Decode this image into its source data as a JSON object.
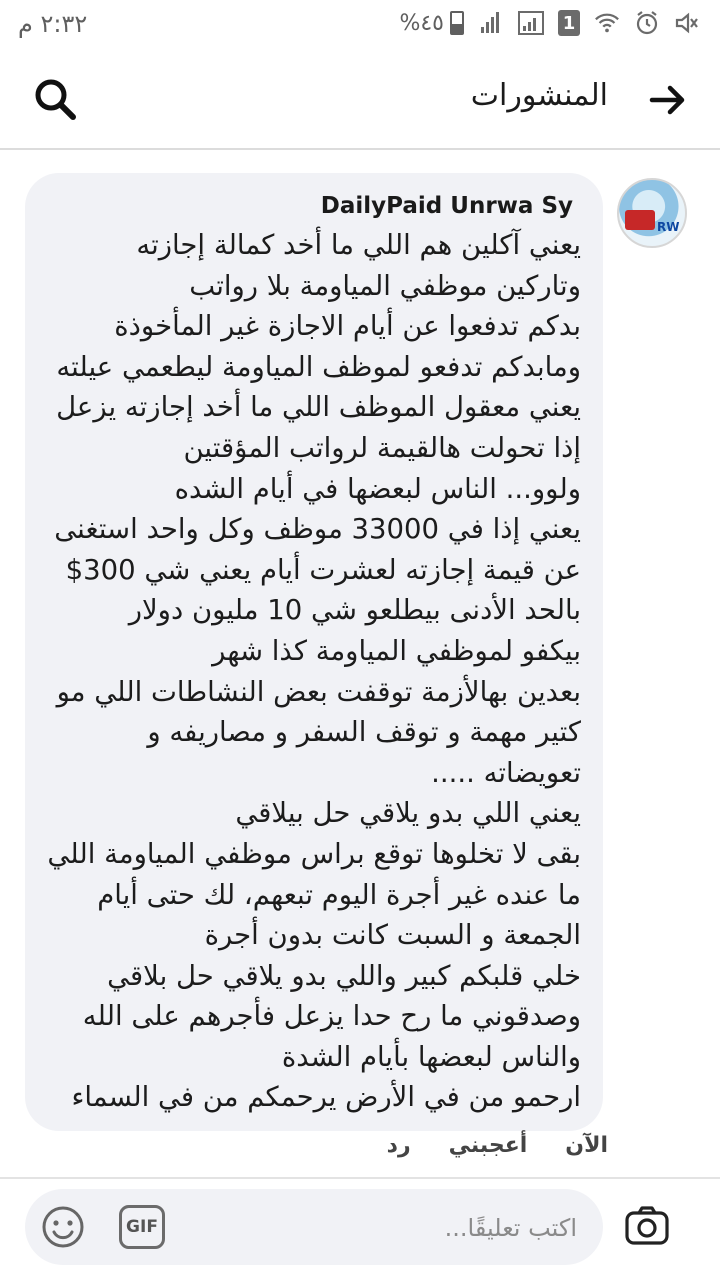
{
  "status_bar": {
    "time": "٢:٣٢ م",
    "battery": "%٤٥",
    "notification_badge": "1"
  },
  "header": {
    "title": "المنشورات"
  },
  "comment": {
    "author": "DailyPaid Unrwa Sy",
    "avatar_text": "RW",
    "lines": [
      "يعني آكلين هم اللي ما أخد كمالة إجازته",
      "وتاركين موظفي المياومة بلا رواتب",
      "بدكم تدفعوا عن أيام الاجازة غير المأخوذة",
      "ومابدكم تدفعو لموظف المياومة ليطعمي عيلته",
      "يعني معقول الموظف اللي ما أخد إجازته يزعل",
      "إذا تحولت هالقيمة لرواتب المؤقتين",
      "ولوو... الناس لبعضها في أيام الشده",
      "يعني إذا في 33000 موظف وكل واحد استغنى",
      "عن قيمة إجازته لعشرت أيام  يعني شي 300$",
      "بالحد الأدنى بيطلعو شي 10 مليون دولار",
      "بيكفو لموظفي المياومة كذا شهر",
      "بعدين بهالأزمة توقفت بعض النشاطات اللي مو",
      "كتير مهمة و توقف السفر و مصاريفه و",
      "تعويضاته .....",
      "يعني اللي بدو يلاقي حل بيلاقي",
      "بقى لا تخلوها توقع براس موظفي المياومة اللي",
      "ما عنده غير أجرة اليوم تبعهم، لك حتى أيام",
      "الجمعة و السبت كانت بدون أجرة",
      "خلي قلبكم كبير واللي بدو يلاقي حل بلاقي",
      "وصدقوني ما رح حدا يزعل فأجرهم على الله",
      "والناس لبعضها بأيام الشدة",
      "ارحمو من في الأرض يرحمكم من في السماء"
    ],
    "actions": {
      "time": "الآن",
      "like": "أعجبني",
      "reply": "رد"
    }
  },
  "composer": {
    "placeholder": "اكتب تعليقًا...",
    "gif_label": "GIF"
  },
  "colors": {
    "bubble": "#f1f2f6",
    "text": "#1c1c1c",
    "icon": "#222222"
  }
}
